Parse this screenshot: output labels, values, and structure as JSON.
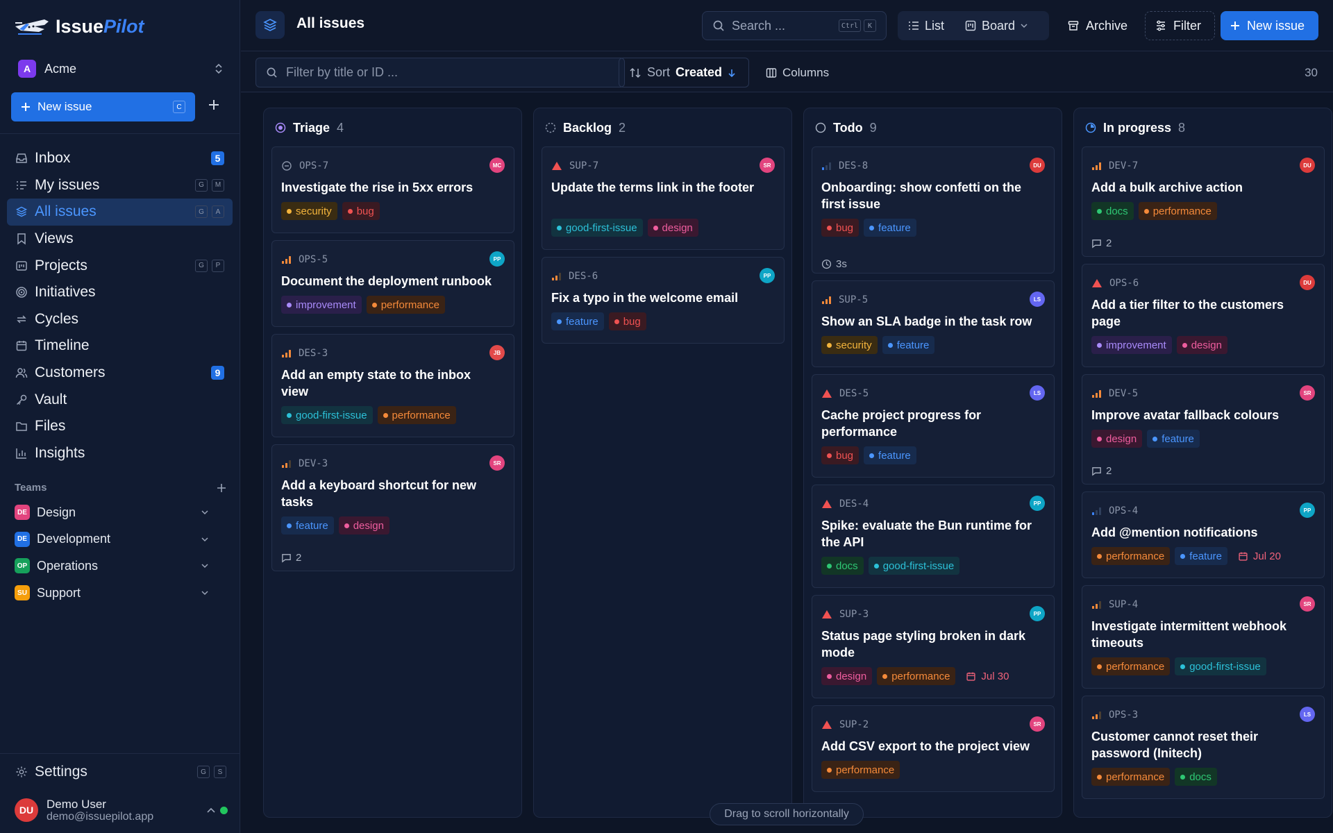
{
  "app": {
    "name_a": "Issue",
    "name_b": "Pilot"
  },
  "workspace": {
    "initial": "A",
    "name": "Acme"
  },
  "sidebar": {
    "new_issue_label": "New issue",
    "new_issue_kbd": "C",
    "nav": [
      {
        "label": "Inbox",
        "icon": "inbox-icon",
        "badge": "5"
      },
      {
        "label": "My issues",
        "icon": "my-issues-icon",
        "kbd": [
          "G",
          "M"
        ]
      },
      {
        "label": "All issues",
        "icon": "layers-icon",
        "kbd": [
          "G",
          "A"
        ],
        "active": true
      },
      {
        "label": "Views",
        "icon": "bookmark-icon"
      },
      {
        "label": "Projects",
        "icon": "projects-icon",
        "kbd": [
          "G",
          "P"
        ]
      },
      {
        "label": "Initiatives",
        "icon": "target-icon"
      },
      {
        "label": "Cycles",
        "icon": "cycle-icon"
      },
      {
        "label": "Timeline",
        "icon": "calendar-icon"
      },
      {
        "label": "Customers",
        "icon": "users-icon",
        "badge": "9"
      },
      {
        "label": "Vault",
        "icon": "key-icon"
      },
      {
        "label": "Files",
        "icon": "folder-icon"
      },
      {
        "label": "Insights",
        "icon": "bar-chart-icon"
      }
    ],
    "teams_heading": "Teams",
    "teams": [
      {
        "initials": "DE",
        "name": "Design",
        "color": "#e2447e"
      },
      {
        "initials": "DE",
        "name": "Development",
        "color": "#2170e4"
      },
      {
        "initials": "OP",
        "name": "Operations",
        "color": "#16a05b"
      },
      {
        "initials": "SU",
        "name": "Support",
        "color": "#f59e0b"
      }
    ],
    "settings_label": "Settings",
    "settings_kbd": [
      "G",
      "S"
    ],
    "user": {
      "initials": "DU",
      "name": "Demo User",
      "email": "demo@issuepilot.app"
    }
  },
  "topbar": {
    "title": "All issues",
    "search_placeholder": "Search ...",
    "search_kbd": [
      "Ctrl",
      "K"
    ],
    "view_list": "List",
    "view_board": "Board",
    "archive": "Archive",
    "filter": "Filter",
    "new_issue": "New issue"
  },
  "subbar": {
    "filter_placeholder": "Filter by title or ID ...",
    "sort_label": "Sort",
    "sort_value": "Created",
    "columns_label": "Columns",
    "count": "30"
  },
  "tag_colors": {
    "security": {
      "bg": "#3a2c12",
      "fg": "#f3b43c",
      "dot": "#f3b43c"
    },
    "bug": {
      "bg": "#3a1a22",
      "fg": "#f05252",
      "dot": "#f05252"
    },
    "improvement": {
      "bg": "#2a1f4a",
      "fg": "#a98bfa",
      "dot": "#a98bfa"
    },
    "performance": {
      "bg": "#3a2315",
      "fg": "#f58a3a",
      "dot": "#f58a3a"
    },
    "good-first-issue": {
      "bg": "#123340",
      "fg": "#2cc1d8",
      "dot": "#2cc1d8"
    },
    "feature": {
      "bg": "#172b4d",
      "fg": "#4b96ff",
      "dot": "#4b96ff"
    },
    "design": {
      "bg": "#3a1830",
      "fg": "#ee5d9e",
      "dot": "#ee5d9e"
    },
    "docs": {
      "bg": "#123626",
      "fg": "#2ec774",
      "dot": "#2ec774"
    }
  },
  "columns": [
    {
      "name": "Triage",
      "count": "4",
      "status_icon": "triage-icon",
      "cards": [
        {
          "id": "OPS-7",
          "priority": "none",
          "avatar": "MC",
          "avatar_color": "#e2447e",
          "title": "Investigate the rise in 5xx errors",
          "tags": [
            "security",
            "bug"
          ]
        },
        {
          "id": "OPS-5",
          "priority": "high",
          "avatar": "PP",
          "avatar_color": "#0ea5c6",
          "title": "Document the deployment runbook",
          "tags": [
            "improvement",
            "performance"
          ]
        },
        {
          "id": "DES-3",
          "priority": "high",
          "avatar": "JB",
          "avatar_color": "#e24a4a",
          "title": "Add an empty state to the inbox view",
          "tags": [
            "good-first-issue",
            "performance"
          ]
        },
        {
          "id": "DEV-3",
          "priority": "medium",
          "avatar": "SR",
          "avatar_color": "#e2447e",
          "title": "Add a keyboard shortcut for new tasks",
          "tags": [
            "feature",
            "design"
          ],
          "comments": "2"
        }
      ]
    },
    {
      "name": "Backlog",
      "count": "2",
      "status_icon": "backlog-icon",
      "cards": [
        {
          "id": "SUP-7",
          "priority": "urgent",
          "avatar": "SR",
          "avatar_color": "#e2447e",
          "title": "Update the terms link in the footer",
          "tags": [
            "good-first-issue",
            "design"
          ]
        },
        {
          "id": "DES-6",
          "priority": "medium",
          "avatar": "PP",
          "avatar_color": "#0ea5c6",
          "title": "Fix a typo in the welcome email",
          "tags": [
            "feature",
            "bug"
          ]
        }
      ]
    },
    {
      "name": "Todo",
      "count": "9",
      "status_icon": "todo-icon",
      "cards": [
        {
          "id": "DES-8",
          "priority": "low",
          "avatar": "DU",
          "avatar_color": "#dc3b3b",
          "title": "Onboarding: show confetti on the first issue",
          "tags": [
            "bug",
            "feature"
          ],
          "estimate": "3s"
        },
        {
          "id": "SUP-5",
          "priority": "high",
          "avatar": "LS",
          "avatar_color": "#6366f1",
          "title": "Show an SLA badge in the task row",
          "tags": [
            "security",
            "feature"
          ]
        },
        {
          "id": "DES-5",
          "priority": "urgent",
          "avatar": "LS",
          "avatar_color": "#6366f1",
          "title": "Cache project progress for performance",
          "tags": [
            "bug",
            "feature"
          ]
        },
        {
          "id": "DES-4",
          "priority": "urgent",
          "avatar": "PP",
          "avatar_color": "#0ea5c6",
          "title": "Spike: evaluate the Bun runtime for the API",
          "tags": [
            "docs",
            "good-first-issue"
          ]
        },
        {
          "id": "SUP-3",
          "priority": "urgent",
          "avatar": "PP",
          "avatar_color": "#0ea5c6",
          "title": "Status page styling broken in dark mode",
          "tags": [
            "design",
            "performance"
          ],
          "due": "Jul 30"
        },
        {
          "id": "SUP-2",
          "priority": "urgent",
          "avatar": "SR",
          "avatar_color": "#e2447e",
          "title": "Add CSV export to the project view",
          "tags": [
            "performance"
          ]
        }
      ]
    },
    {
      "name": "In progress",
      "count": "8",
      "status_icon": "in-progress-icon",
      "cards": [
        {
          "id": "DEV-7",
          "priority": "high",
          "avatar": "DU",
          "avatar_color": "#dc3b3b",
          "title": "Add a bulk archive action",
          "tags": [
            "docs",
            "performance"
          ],
          "comments": "2"
        },
        {
          "id": "OPS-6",
          "priority": "urgent",
          "avatar": "DU",
          "avatar_color": "#dc3b3b",
          "title": "Add a tier filter to the customers page",
          "tags": [
            "improvement",
            "design"
          ]
        },
        {
          "id": "DEV-5",
          "priority": "high",
          "avatar": "SR",
          "avatar_color": "#e2447e",
          "title": "Improve avatar fallback colours",
          "tags": [
            "design",
            "feature"
          ],
          "comments": "2"
        },
        {
          "id": "OPS-4",
          "priority": "low",
          "avatar": "PP",
          "avatar_color": "#0ea5c6",
          "title": "Add @mention notifications",
          "tags": [
            "performance",
            "feature"
          ],
          "due": "Jul 20"
        },
        {
          "id": "SUP-4",
          "priority": "medium",
          "avatar": "SR",
          "avatar_color": "#e2447e",
          "title": "Investigate intermittent webhook timeouts",
          "tags": [
            "performance",
            "good-first-issue"
          ]
        },
        {
          "id": "OPS-3",
          "priority": "medium",
          "avatar": "LS",
          "avatar_color": "#6366f1",
          "title": "Customer cannot reset their password (Initech)",
          "tags": [
            "performance",
            "docs"
          ]
        }
      ]
    }
  ],
  "scroll_hint": "Drag to scroll horizontally"
}
